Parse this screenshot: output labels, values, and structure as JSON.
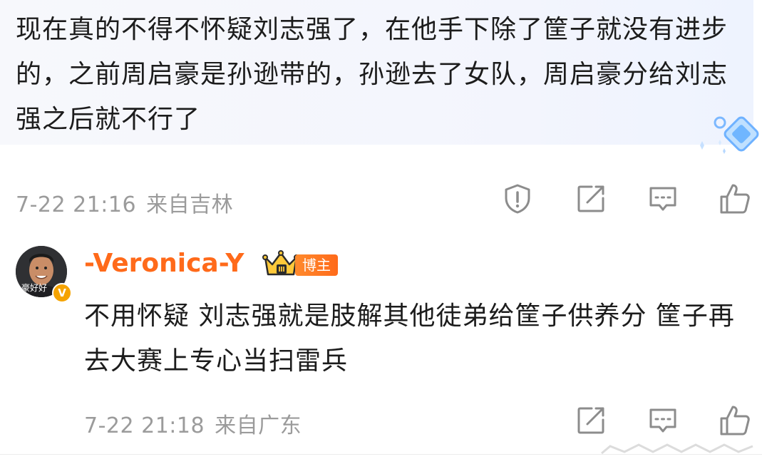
{
  "comment": {
    "text": "现在真的不得不怀疑刘志强了，在他手下除了筐子就没有进步的，之前周启豪是孙逊带的，孙逊去了女队，周启豪分给刘志强之后就不行了",
    "time": "7-22 21:16",
    "location": "来自吉林"
  },
  "reply": {
    "username": "-Veronica-Y",
    "owner_label": "博主",
    "avatar_caption": "豪好好",
    "verified_mark": "V",
    "text": "不用怀疑 刘志强就是肢解其他徒弟给筐子供养分 筐子再去大赛上专心当扫雷兵",
    "time": "7-22 21:18",
    "location": "来自广东"
  },
  "icons": {
    "report": "report-icon",
    "share": "share-icon",
    "comment": "comment-icon",
    "like": "like-icon"
  },
  "colors": {
    "username": "#ff6a1a",
    "meta": "#9b9b9b",
    "text": "#1c1c1c",
    "icon": "#8c8c8c"
  }
}
